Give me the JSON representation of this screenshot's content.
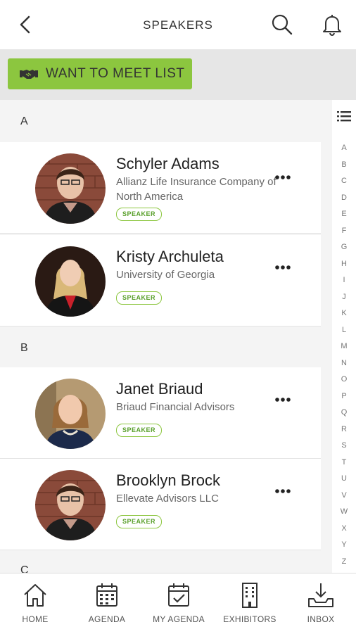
{
  "header": {
    "title": "SPEAKERS"
  },
  "meet_list": {
    "label": "WANT TO MEET LIST"
  },
  "sections": [
    {
      "letter": "A",
      "speakers": [
        {
          "name": "Schyler Adams",
          "company": "Allianz Life Insurance Company of North America",
          "badge": "SPEAKER"
        },
        {
          "name": "Kristy Archuleta",
          "company": "University of Georgia",
          "badge": "SPEAKER"
        }
      ]
    },
    {
      "letter": "B",
      "speakers": [
        {
          "name": "Janet Briaud",
          "company": "Briaud Financial Advisors",
          "badge": "SPEAKER"
        },
        {
          "name": "Brooklyn Brock",
          "company": "Ellevate Advisors LLC",
          "badge": "SPEAKER"
        }
      ]
    },
    {
      "letter": "C"
    }
  ],
  "alphabet": [
    "A",
    "B",
    "C",
    "D",
    "E",
    "F",
    "G",
    "H",
    "I",
    "J",
    "K",
    "L",
    "M",
    "N",
    "O",
    "P",
    "Q",
    "R",
    "S",
    "T",
    "U",
    "V",
    "W",
    "X",
    "Y",
    "Z"
  ],
  "nav": [
    {
      "label": "HOME",
      "icon": "home-icon"
    },
    {
      "label": "AGENDA",
      "icon": "calendar-icon"
    },
    {
      "label": "MY AGENDA",
      "icon": "calendar-check-icon"
    },
    {
      "label": "EXHIBITORS",
      "icon": "building-icon"
    },
    {
      "label": "INBOX",
      "icon": "inbox-download-icon"
    }
  ],
  "colors": {
    "accent": "#8cc63f",
    "badge_text": "#5aa02c"
  }
}
